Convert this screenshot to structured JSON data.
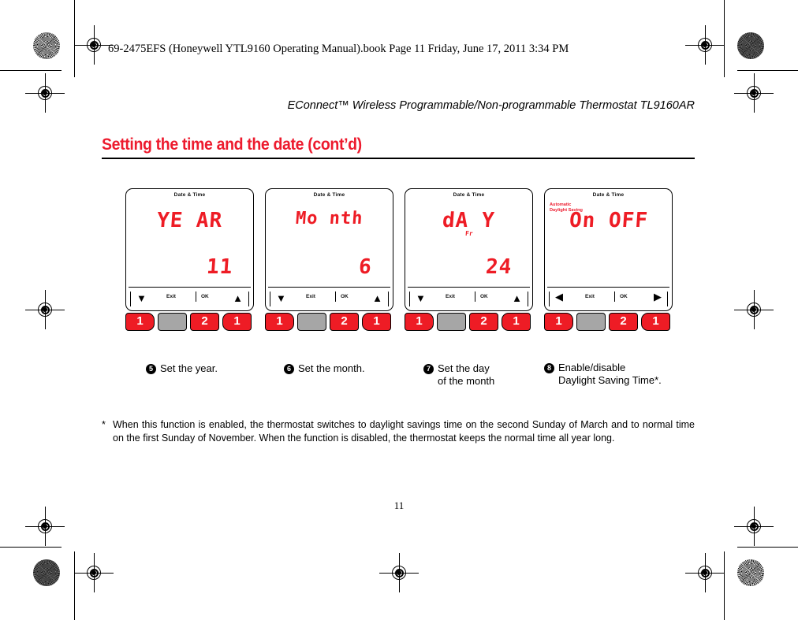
{
  "print": {
    "book_line": "69-2475EFS (Honeywell YTL9160 Operating Manual).book  Page 11  Friday, June 17, 2011  3:34 PM",
    "page_number": "11"
  },
  "running_head": "EConnect™ Wireless Programmable/Non-programmable Thermostat TL9160AR",
  "section": {
    "title": "Setting the time and the date (cont’d)",
    "title_color": "#ed1b2e"
  },
  "figure": {
    "lcd_red": "#ee1c25",
    "key_grey": "#a6a6a6",
    "thermostats": [
      {
        "header": "Date & Time",
        "sub_label": "",
        "word": "YE AR",
        "dow": "",
        "value": "11",
        "legend": {
          "left_arrow": "▼",
          "right_arrow": "▲",
          "exit": "Exit",
          "ok": "OK"
        },
        "keys": [
          "1",
          "",
          "2",
          "1"
        ]
      },
      {
        "header": "Date & Time",
        "sub_label": "",
        "word": "Mo nth",
        "dow": "",
        "value": "6",
        "legend": {
          "left_arrow": "▼",
          "right_arrow": "▲",
          "exit": "Exit",
          "ok": "OK"
        },
        "keys": [
          "1",
          "",
          "2",
          "1"
        ]
      },
      {
        "header": "Date & Time",
        "sub_label": "",
        "word": "dA Y",
        "dow": "Fr",
        "value": "24",
        "legend": {
          "left_arrow": "▼",
          "right_arrow": "▲",
          "exit": "Exit",
          "ok": "OK"
        },
        "keys": [
          "1",
          "",
          "2",
          "1"
        ]
      },
      {
        "header": "Date & Time",
        "sub_label": "Automatic\nDaylight Saving",
        "word": "On OFF",
        "dow": "",
        "value": "",
        "legend": {
          "left_arrow": "◀",
          "right_arrow": "▶",
          "exit": "Exit",
          "ok": "OK"
        },
        "keys": [
          "1",
          "",
          "2",
          "1"
        ]
      }
    ]
  },
  "captions": [
    {
      "number": "5",
      "text": "Set the year."
    },
    {
      "number": "6",
      "text": "Set the month."
    },
    {
      "number": "7",
      "text": "Set the day\nof the month"
    },
    {
      "number": "8",
      "text": "Enable/disable\nDaylight Saving Time*."
    }
  ],
  "footnote": {
    "marker": "*",
    "text": "When this function is enabled, the thermostat switches to daylight savings time on the second Sunday of March and to normal time on the first Sunday of November. When the function is disabled, the thermostat keeps the normal time all year long."
  }
}
